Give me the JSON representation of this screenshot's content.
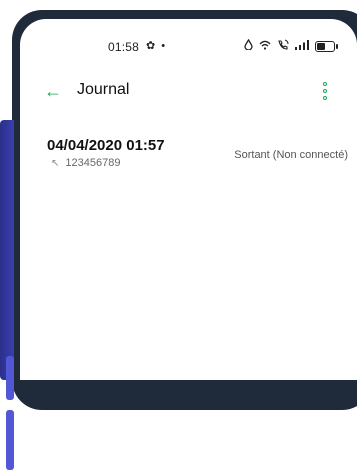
{
  "status_bar": {
    "time": "01:58",
    "left_icons": [
      "settings-icon",
      "dot-icon"
    ],
    "right_icons": [
      "droplet-icon",
      "wifi-icon",
      "wifi-call-icon",
      "signal-icon",
      "battery-icon"
    ]
  },
  "toolbar": {
    "back_glyph": "←",
    "title": "Journal"
  },
  "log_entries": [
    {
      "datetime": "04/04/2020 01:57",
      "number": "123456789",
      "direction_glyph": "↖",
      "type": "Sortant (Non connecté)"
    }
  ],
  "colors": {
    "accent": "#1fa45b",
    "frame": "#1f2a3a",
    "side_accent": "#3b3fb0"
  }
}
